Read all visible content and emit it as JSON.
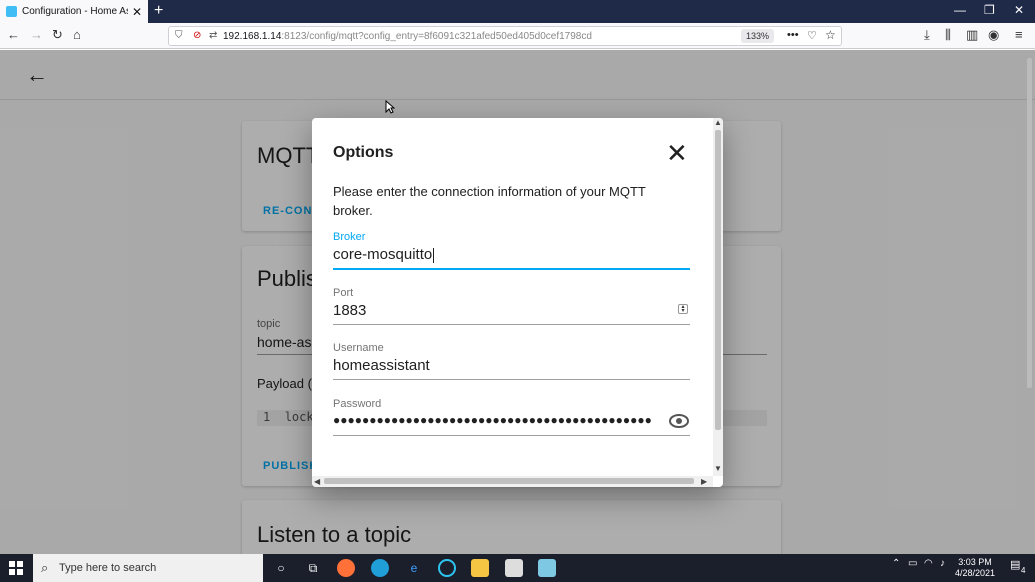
{
  "browser": {
    "tab_title": "Configuration - Home Assistant",
    "tab_close": "✕",
    "new_tab": "+",
    "url_host": "192.168.1.14",
    "url_rest": ":8123/config/mqtt?config_entry=8f6091c321afed50ed405d0cef1798cd",
    "zoom": "133%",
    "window_controls": {
      "minimize": "—",
      "maximize": "❐",
      "close": "✕"
    }
  },
  "page": {
    "back_icon": "←",
    "card1": {
      "title": "MQTT",
      "action": "RE-CONF"
    },
    "card2": {
      "title": "Publis",
      "topic_label": "topic",
      "topic_value": "home-as",
      "payload_label": "Payload (t",
      "code_line_no": "1",
      "code_text": "lock",
      "action": "PUBLISH"
    },
    "card3": {
      "title": "Listen to a topic"
    }
  },
  "dialog": {
    "title": "Options",
    "close_icon": "✕",
    "description": "Please enter the connection information of your MQTT broker.",
    "broker": {
      "label": "Broker",
      "value": "core-mosquitto"
    },
    "port": {
      "label": "Port",
      "value": "1883"
    },
    "username": {
      "label": "Username",
      "value": "homeassistant"
    },
    "password": {
      "label": "Password",
      "value": "●●●●●●●●●●●●●●●●●●●●●●●●●●●●●●●●●●●●●●●●●●●●"
    }
  },
  "taskbar": {
    "search_placeholder": "Type here to search",
    "time": "3:03 PM",
    "date": "4/28/2021",
    "notification_count": "4"
  },
  "colors": {
    "accent": "#03a9f4",
    "taskbar": "#1b1e2b",
    "tabstrip": "#1f2a48"
  }
}
